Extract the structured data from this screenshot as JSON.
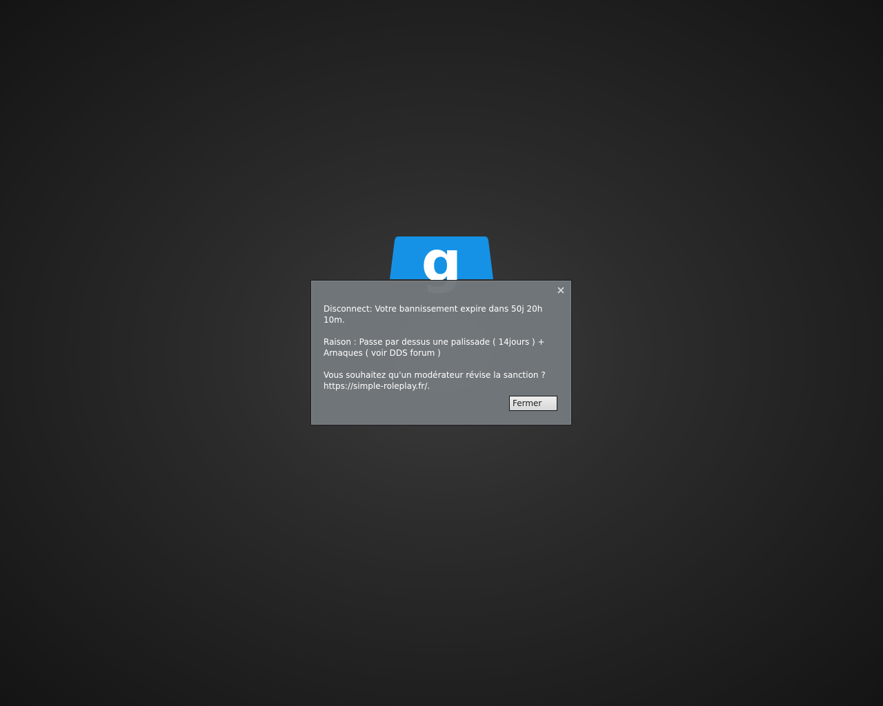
{
  "logo": {
    "name": "garrysmod-logo",
    "letter": "g",
    "color": "#1592e6"
  },
  "dialog": {
    "close_icon": "close-icon",
    "line1": "Disconnect: Votre bannissement expire dans 50j 20h 10m.",
    "line2": "Raison : Passe par dessus une palissade ( 14jours ) + Arnaques ( voir DDS forum )",
    "line3": "Vous souhaitez qu'un modérateur révise la sanction ? https://simple-roleplay.fr/.",
    "close_button": "Fermer"
  }
}
